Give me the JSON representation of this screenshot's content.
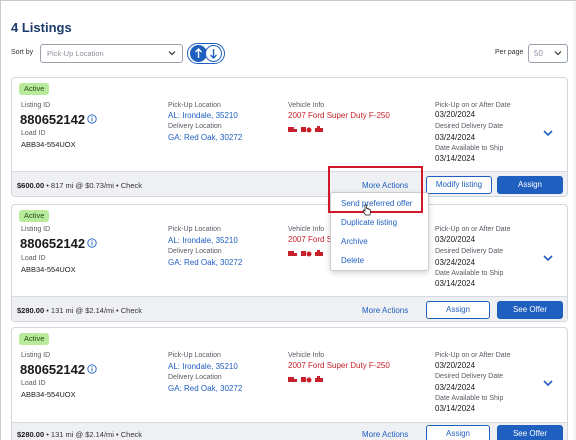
{
  "page": {
    "title": "4 Listings"
  },
  "toolbar": {
    "sort_label": "Sort by",
    "sort_placeholder": "Pick-Up Location",
    "per_page_label": "Per page",
    "per_page_value": "50"
  },
  "labels": {
    "status": "Active",
    "listing_id": "Listing ID",
    "load_id": "Load ID",
    "pickup_location": "Pick-Up Location",
    "delivery_location": "Delivery Location",
    "vehicle_info": "Vehicle Info",
    "pickup_date": "Pick-Up on or After Date",
    "desired_delivery": "Desired Delivery Date",
    "available_to_ship": "Date Available to Ship",
    "more_actions": "More Actions",
    "modify_listing": "Modify listing",
    "assign": "Assign",
    "see_offer": "See Offer"
  },
  "listings": [
    {
      "listing_id": "880652142",
      "load_id": "ABB34-554UOX",
      "pickup": "AL: Irondale, 35210",
      "delivery": "GA: Red Oak, 30272",
      "vehicle": "2007 Ford Super Duty F-250",
      "pickup_date": "03/20/2024",
      "desired_delivery": "03/24/2024",
      "available_date": "03/14/2024",
      "price": "$600.00",
      "price_detail": " • 817 mi @ $0.73/mi • Check"
    },
    {
      "listing_id": "880652142",
      "load_id": "ABB34-554UOX",
      "pickup": "AL: Irondale, 35210",
      "delivery": "GA: Red Oak, 30272",
      "vehicle": "2007 Ford S",
      "pickup_date": "03/20/2024",
      "desired_delivery": "03/24/2024",
      "available_date": "03/14/2024",
      "price": "$280.00",
      "price_detail": " • 131 mi @ $2.14/mi • Check"
    },
    {
      "listing_id": "880652142",
      "load_id": "ABB34-554UOX",
      "pickup": "AL: Irondale, 35210",
      "delivery": "GA: Red Oak, 30272",
      "vehicle": "2007 Ford Super Duty F-250",
      "pickup_date": "03/20/2024",
      "desired_delivery": "03/24/2024",
      "available_date": "03/14/2024",
      "price": "$280.00",
      "price_detail": " • 131 mi @ $2.14/mi • Check"
    }
  ],
  "dropdown_menu": {
    "items": [
      "Send preferred offer",
      "Duplicate listing",
      "Archive",
      "Delete"
    ]
  },
  "colors": {
    "accent": "#1f5fbf",
    "badge": "#b9ea9c",
    "vehicle_text": "#c8202a",
    "highlight": "#d0182a"
  }
}
